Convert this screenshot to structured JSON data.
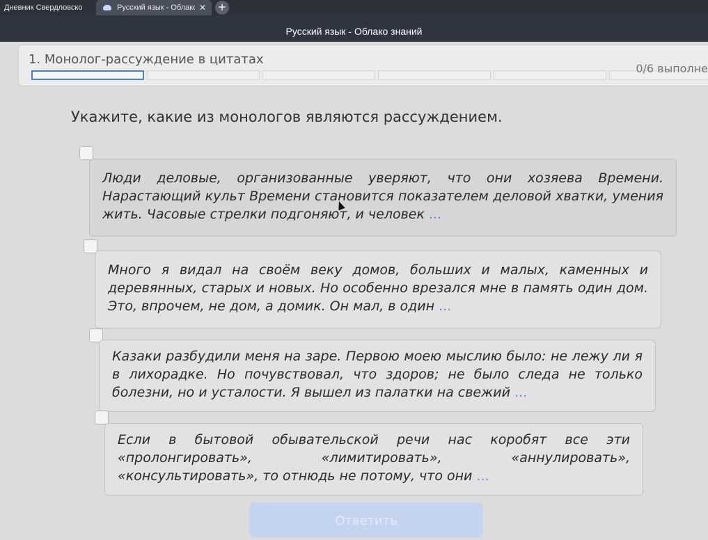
{
  "browser": {
    "tabs": [
      {
        "label": "Дневник Свердловской о",
        "active": false
      },
      {
        "label": "Русский язык - Облако",
        "active": true
      }
    ],
    "new_tab": "+",
    "close": "✕"
  },
  "header": {
    "title": "Русский язык - Облако знаний"
  },
  "task": {
    "title": "1. Монолог-рассуждение в цитатах",
    "progress": "0/6 выполне",
    "segments_total": 6,
    "current_segment": 1
  },
  "question": "Укажите, какие из монологов являются рассуждением.",
  "options": [
    {
      "text": "Люди деловые, организованные уверяют, что они хозяева Времени. Нарастающий культ Времени становится показателем деловой хватки, умения жить. Часовые стрелки подгоняют, и человек",
      "more": "...",
      "selected": false
    },
    {
      "text": "Много я видал на своём веку домов, больших и малых, каменных и деревянных, старых и новых. Но особенно врезался мне в память один дом. Это, впрочем, не дом, а домик. Он мал, в один",
      "more": "...",
      "selected": false
    },
    {
      "text": "Казаки разбудили меня на заре. Первою моею мыслию было: не лежу ли я в лихорадке. Но почувствовал, что здоров; не было следа не только болезни, но и усталости. Я вышел из палатки на свежий",
      "more": "...",
      "selected": false
    },
    {
      "text": "Если в бытовой обывательской речи нас коробят все эти «пролонгировать», «лимитировать», «аннулировать», «консультировать», то отнюдь не потому, что они",
      "more": "...",
      "selected": false
    }
  ],
  "answer_button": "Ответить",
  "colors": {
    "accent": "#4a7fc1",
    "link": "#5d8cd9",
    "header_bg": "#2e3440"
  }
}
